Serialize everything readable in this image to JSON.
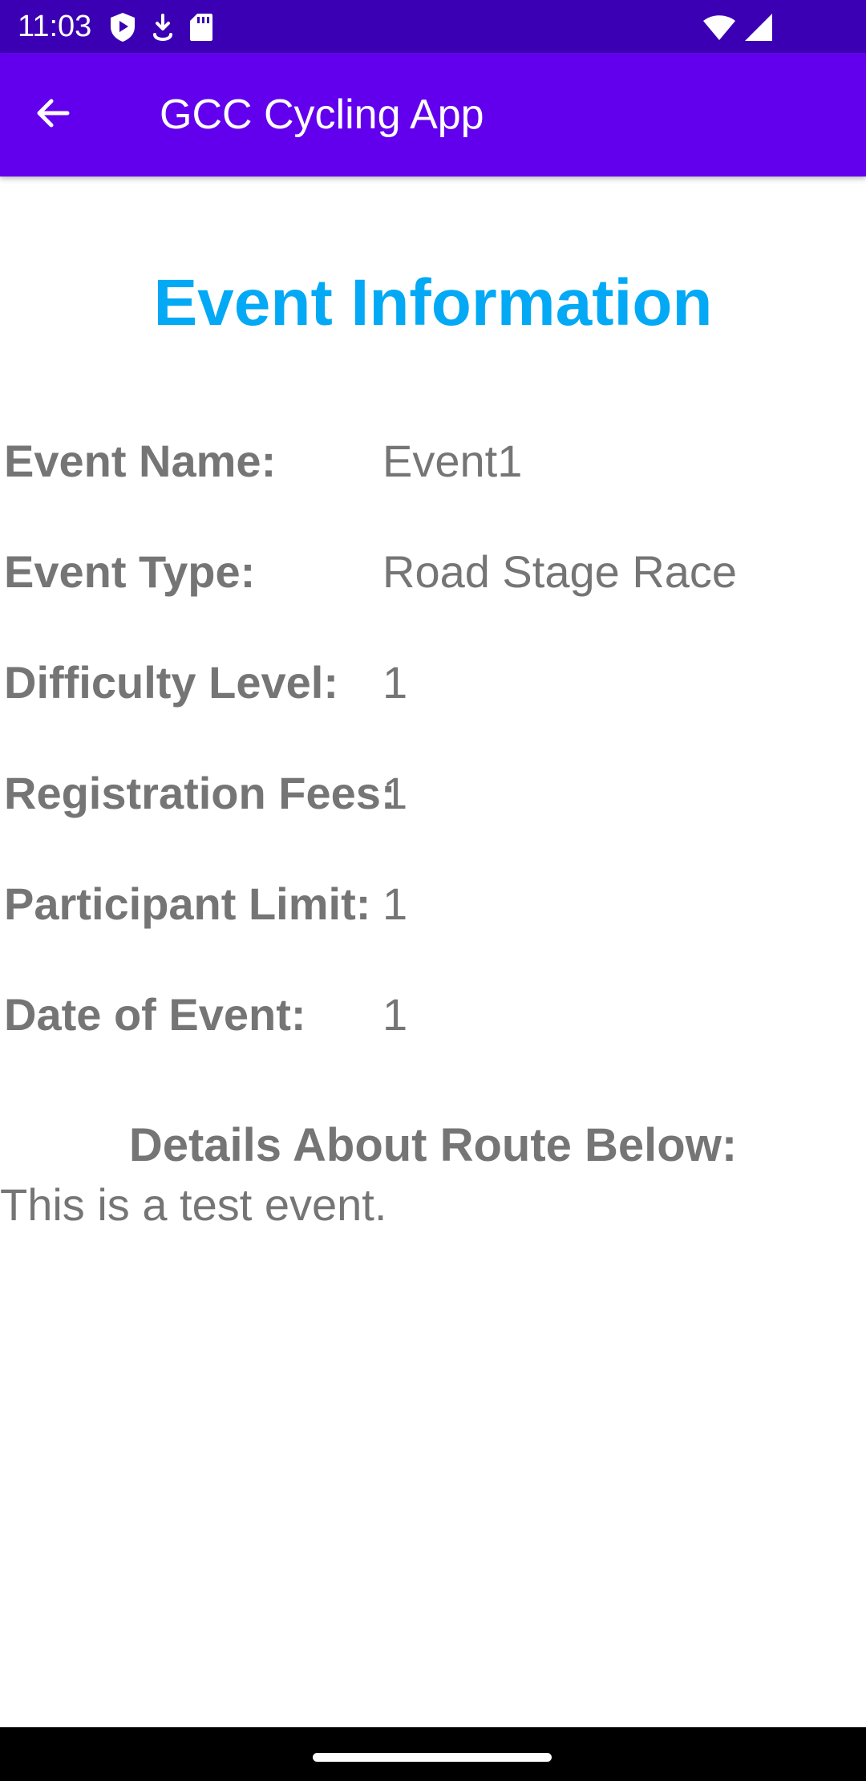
{
  "status_bar": {
    "time": "11:03",
    "left_icons": [
      "shield-icon",
      "download-icon",
      "sd-card-icon"
    ],
    "right_icons": [
      "wifi-icon",
      "signal-icon"
    ]
  },
  "app_bar": {
    "title": "GCC Cycling App",
    "back_icon": "arrow-back-icon",
    "color": "#6200ee"
  },
  "page": {
    "title": "Event Information",
    "title_color": "#03a9f4"
  },
  "event_info": [
    {
      "label": "Event Name:",
      "value": "Event1"
    },
    {
      "label": "Event Type:",
      "value": "Road Stage Race"
    },
    {
      "label": "Difficulty Level:",
      "value": "1"
    },
    {
      "label": "Registration Fees:",
      "value": "1"
    },
    {
      "label": "Participant Limit:",
      "value": "1"
    },
    {
      "label": "Date of Event:",
      "value": "1"
    }
  ],
  "route": {
    "heading": "Details About Route Below:",
    "details": "This is a test event."
  }
}
